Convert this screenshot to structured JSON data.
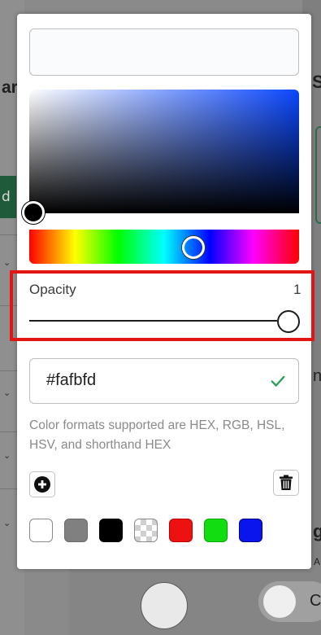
{
  "background": {
    "fragments": [
      "ar",
      "S",
      "d",
      "n",
      "g",
      "A",
      "C"
    ]
  },
  "picker": {
    "preview_color": "#fafbfd",
    "opacity": {
      "label": "Opacity",
      "value": "1",
      "level": 1.0
    },
    "hex_input": {
      "value": "#fafbfd"
    },
    "formats_note": "Color formats supported are HEX, RGB, HSL, HSV, and shorthand HEX",
    "icons": {
      "add": "plus-circle-icon",
      "delete": "trash-icon",
      "confirm": "check-icon"
    },
    "swatches": [
      {
        "name": "white",
        "color": "#ffffff"
      },
      {
        "name": "gray",
        "color": "#808080"
      },
      {
        "name": "black",
        "color": "#000000"
      },
      {
        "name": "transparent",
        "color": "transparent"
      },
      {
        "name": "red",
        "color": "#ee1111"
      },
      {
        "name": "green",
        "color": "#11dd11"
      },
      {
        "name": "blue",
        "color": "#0a15ee"
      }
    ]
  }
}
